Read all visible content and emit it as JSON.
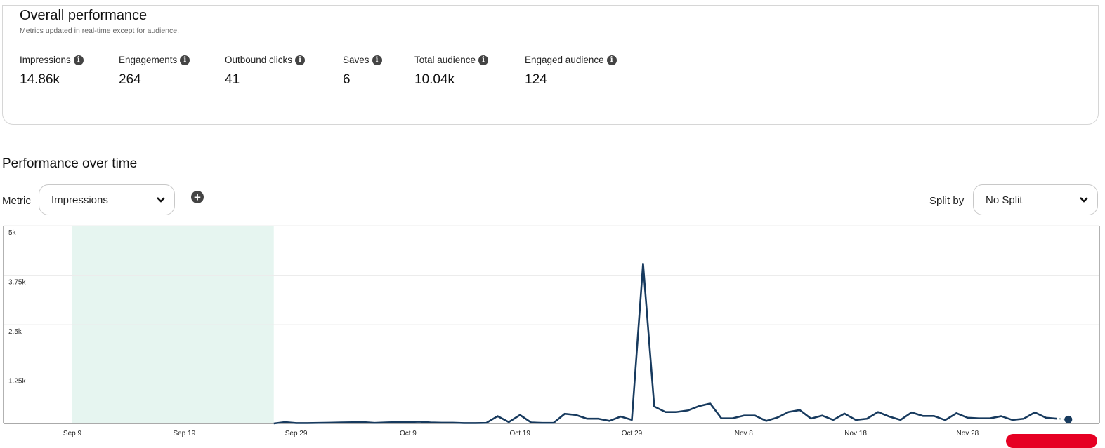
{
  "overall": {
    "title": "Overall performance",
    "subtitle": "Metrics updated in real-time except for audience.",
    "metrics": [
      {
        "label": "Impressions",
        "value": "14.86k"
      },
      {
        "label": "Engagements",
        "value": "264"
      },
      {
        "label": "Outbound clicks",
        "value": "41"
      },
      {
        "label": "Saves",
        "value": "6"
      },
      {
        "label": "Total audience",
        "value": "10.04k"
      },
      {
        "label": "Engaged audience",
        "value": "124"
      }
    ],
    "info_icon": "info-icon"
  },
  "over_time": {
    "title": "Performance over time",
    "metric_label": "Metric",
    "metric_value": "Impressions",
    "split_label": "Split by",
    "split_value": "No Split",
    "add_icon": "plus-circle-icon"
  },
  "colors": {
    "line": "#173a5e",
    "highlight": "#e6f5f0",
    "accent": "#e60023"
  },
  "chart_data": {
    "type": "line",
    "ylim": [
      0,
      5000
    ],
    "yticks": [
      "5k",
      "3.75k",
      "2.5k",
      "1.25k"
    ],
    "ytick_values": [
      5000,
      3750,
      2500,
      1250
    ],
    "xticks": [
      "Sep 9",
      "Sep 19",
      "Sep 29",
      "Oct 9",
      "Oct 19",
      "Oct 29",
      "Nov 8",
      "Nov 18",
      "Nov 28"
    ],
    "xlim": [
      "Sep 3",
      "Dec 10"
    ],
    "grid": true,
    "highlight_range": [
      "Sep 9",
      "Sep 27"
    ],
    "x_start": "Sep 27",
    "values": [
      0,
      35,
      10,
      10,
      15,
      20,
      25,
      30,
      35,
      15,
      25,
      35,
      35,
      45,
      25,
      20,
      20,
      10,
      10,
      15,
      185,
      35,
      215,
      25,
      15,
      15,
      245,
      215,
      120,
      120,
      65,
      175,
      90,
      4040,
      430,
      290,
      290,
      330,
      440,
      505,
      130,
      130,
      200,
      200,
      65,
      150,
      290,
      340,
      125,
      200,
      90,
      250,
      90,
      120,
      290,
      175,
      90,
      280,
      190,
      190,
      85,
      260,
      145,
      130,
      130,
      185,
      90,
      120,
      280,
      145,
      120
    ],
    "partial_point": {
      "x": "Dec 7",
      "y": 100
    }
  }
}
